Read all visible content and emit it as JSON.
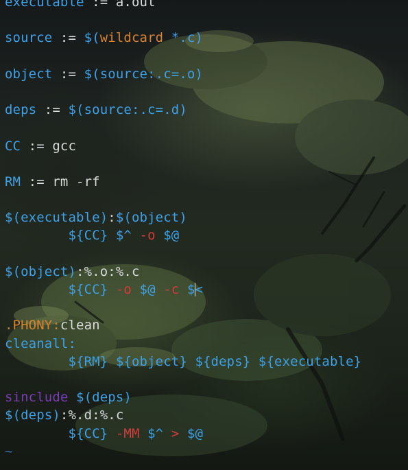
{
  "editor": {
    "lines": [
      {
        "tokens": [
          {
            "t": "executable",
            "c": "var"
          },
          {
            "t": " := ",
            "c": "op"
          },
          {
            "t": "a.out",
            "c": "text"
          }
        ]
      },
      {
        "tokens": []
      },
      {
        "tokens": [
          {
            "t": "source",
            "c": "var"
          },
          {
            "t": " := ",
            "c": "op"
          },
          {
            "t": "$(",
            "c": "var"
          },
          {
            "t": "wildcard",
            "c": "func"
          },
          {
            "t": " *.c)",
            "c": "var"
          }
        ]
      },
      {
        "tokens": []
      },
      {
        "tokens": [
          {
            "t": "object",
            "c": "var"
          },
          {
            "t": " := ",
            "c": "op"
          },
          {
            "t": "$(source:.c=.o)",
            "c": "var"
          }
        ]
      },
      {
        "tokens": []
      },
      {
        "tokens": [
          {
            "t": "deps",
            "c": "var"
          },
          {
            "t": " := ",
            "c": "op"
          },
          {
            "t": "$(source:.c=.d)",
            "c": "var"
          }
        ]
      },
      {
        "tokens": []
      },
      {
        "tokens": [
          {
            "t": "CC",
            "c": "var"
          },
          {
            "t": " := ",
            "c": "op"
          },
          {
            "t": "gcc",
            "c": "text"
          }
        ]
      },
      {
        "tokens": []
      },
      {
        "tokens": [
          {
            "t": "RM",
            "c": "var"
          },
          {
            "t": " := ",
            "c": "op"
          },
          {
            "t": "rm -rf",
            "c": "text"
          }
        ]
      },
      {
        "tokens": []
      },
      {
        "tokens": [
          {
            "t": "$(executable)",
            "c": "var"
          },
          {
            "t": ":",
            "c": "op"
          },
          {
            "t": "$(object)",
            "c": "var"
          }
        ]
      },
      {
        "tokens": [
          {
            "t": "        ",
            "c": "text"
          },
          {
            "t": "${CC}",
            "c": "var"
          },
          {
            "t": " ",
            "c": "text"
          },
          {
            "t": "$^",
            "c": "var"
          },
          {
            "t": " ",
            "c": "text"
          },
          {
            "t": "-o",
            "c": "flag"
          },
          {
            "t": " ",
            "c": "text"
          },
          {
            "t": "$@",
            "c": "var"
          }
        ]
      },
      {
        "tokens": []
      },
      {
        "tokens": [
          {
            "t": "$(object)",
            "c": "var"
          },
          {
            "t": ":%.o:%.c",
            "c": "op"
          }
        ]
      },
      {
        "tokens": [
          {
            "t": "        ",
            "c": "text"
          },
          {
            "t": "${CC}",
            "c": "var"
          },
          {
            "t": " ",
            "c": "text"
          },
          {
            "t": "-o",
            "c": "flag"
          },
          {
            "t": " ",
            "c": "text"
          },
          {
            "t": "$@",
            "c": "var"
          },
          {
            "t": " ",
            "c": "text"
          },
          {
            "t": "-c",
            "c": "flag"
          },
          {
            "t": " ",
            "c": "text"
          },
          {
            "t": "$",
            "c": "var"
          },
          {
            "t": "",
            "c": "cursor"
          },
          {
            "t": "<",
            "c": "var"
          }
        ]
      },
      {
        "tokens": []
      },
      {
        "tokens": [
          {
            "t": ".PHONY:",
            "c": "phony"
          },
          {
            "t": "clean",
            "c": "text"
          }
        ]
      },
      {
        "tokens": [
          {
            "t": "cleanall:",
            "c": "var"
          }
        ]
      },
      {
        "tokens": [
          {
            "t": "        ",
            "c": "text"
          },
          {
            "t": "${RM}",
            "c": "var"
          },
          {
            "t": " ",
            "c": "text"
          },
          {
            "t": "${object}",
            "c": "var"
          },
          {
            "t": " ",
            "c": "text"
          },
          {
            "t": "${deps}",
            "c": "var"
          },
          {
            "t": " ",
            "c": "text"
          },
          {
            "t": "${executable}",
            "c": "var"
          }
        ]
      },
      {
        "tokens": []
      },
      {
        "tokens": [
          {
            "t": "sinclude",
            "c": "kw"
          },
          {
            "t": " ",
            "c": "text"
          },
          {
            "t": "$(deps)",
            "c": "var"
          }
        ]
      },
      {
        "tokens": [
          {
            "t": "$(deps)",
            "c": "var"
          },
          {
            "t": ":%.d:%.c",
            "c": "op"
          }
        ]
      },
      {
        "tokens": [
          {
            "t": "        ",
            "c": "text"
          },
          {
            "t": "${CC}",
            "c": "var"
          },
          {
            "t": " ",
            "c": "text"
          },
          {
            "t": "-MM",
            "c": "flag"
          },
          {
            "t": " ",
            "c": "text"
          },
          {
            "t": "$^",
            "c": "var"
          },
          {
            "t": " ",
            "c": "text"
          },
          {
            "t": ">",
            "c": "flag"
          },
          {
            "t": " ",
            "c": "text"
          },
          {
            "t": "$@",
            "c": "var"
          }
        ]
      },
      {
        "tokens": [
          {
            "t": "~",
            "c": "tilde"
          }
        ]
      }
    ]
  }
}
